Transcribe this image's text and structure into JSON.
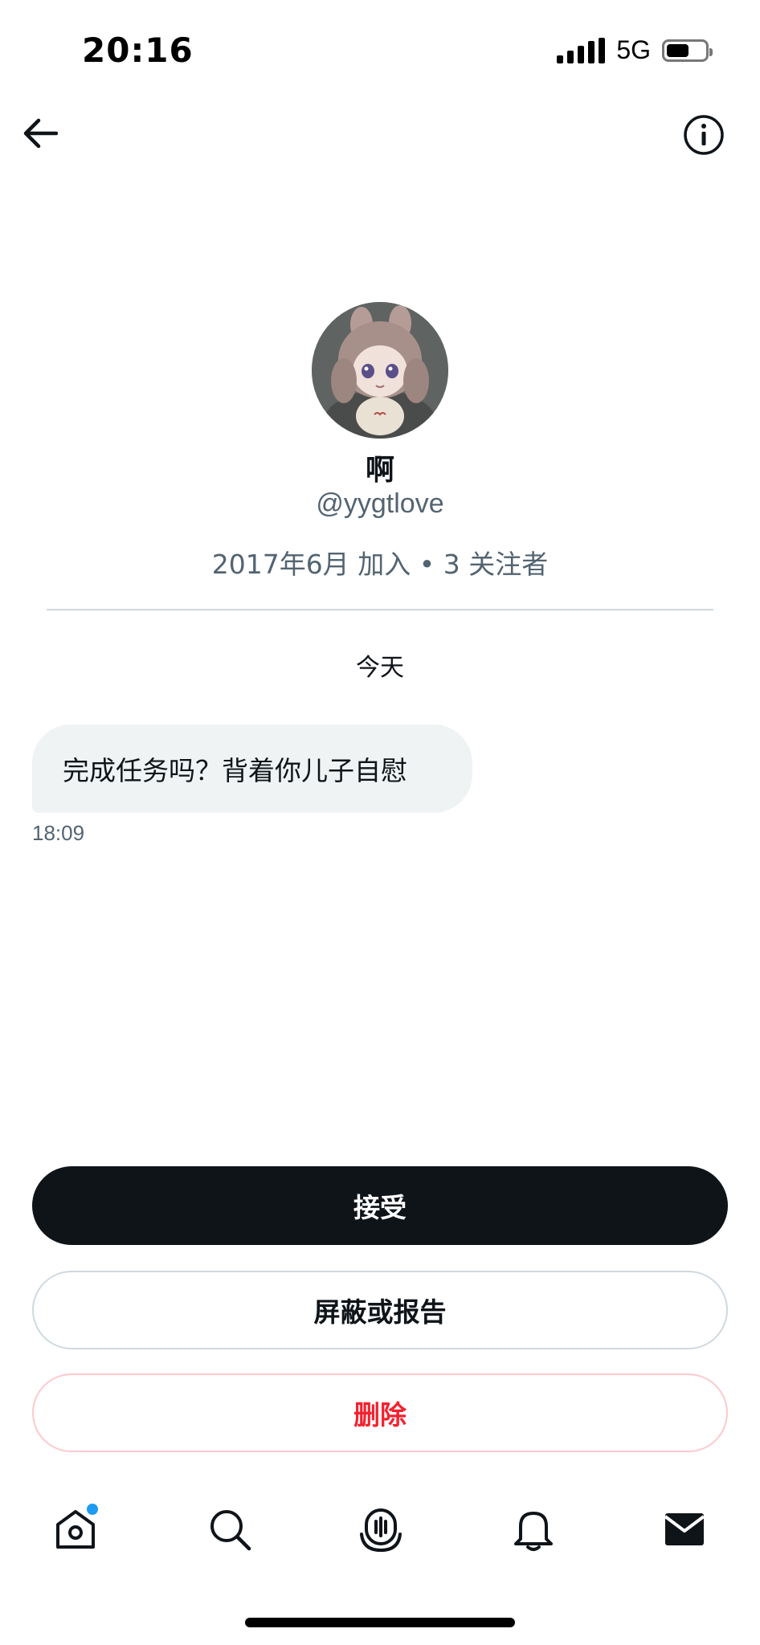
{
  "status_bar": {
    "time": "20:16",
    "network": "5G"
  },
  "profile": {
    "name": "啊",
    "handle": "@yygtlove",
    "meta": "2017年6月 加入 • 3 关注者"
  },
  "conversation": {
    "day_label": "今天",
    "messages": [
      {
        "text": "完成任务吗？背着你儿子自慰",
        "time": "18:09"
      }
    ]
  },
  "actions": {
    "accept_label": "接受",
    "block_label": "屏蔽或报告",
    "delete_label": "删除"
  },
  "colors": {
    "accent": "#1d9bf0",
    "primary_button": "#0f1419",
    "danger": "#f4212e",
    "muted_text": "#536471"
  },
  "icons": {
    "back": "arrow-left-icon",
    "info": "info-icon",
    "home": "home-icon",
    "search": "search-icon",
    "spaces": "microphone-icon",
    "notifications": "bell-icon",
    "messages": "mail-icon"
  }
}
